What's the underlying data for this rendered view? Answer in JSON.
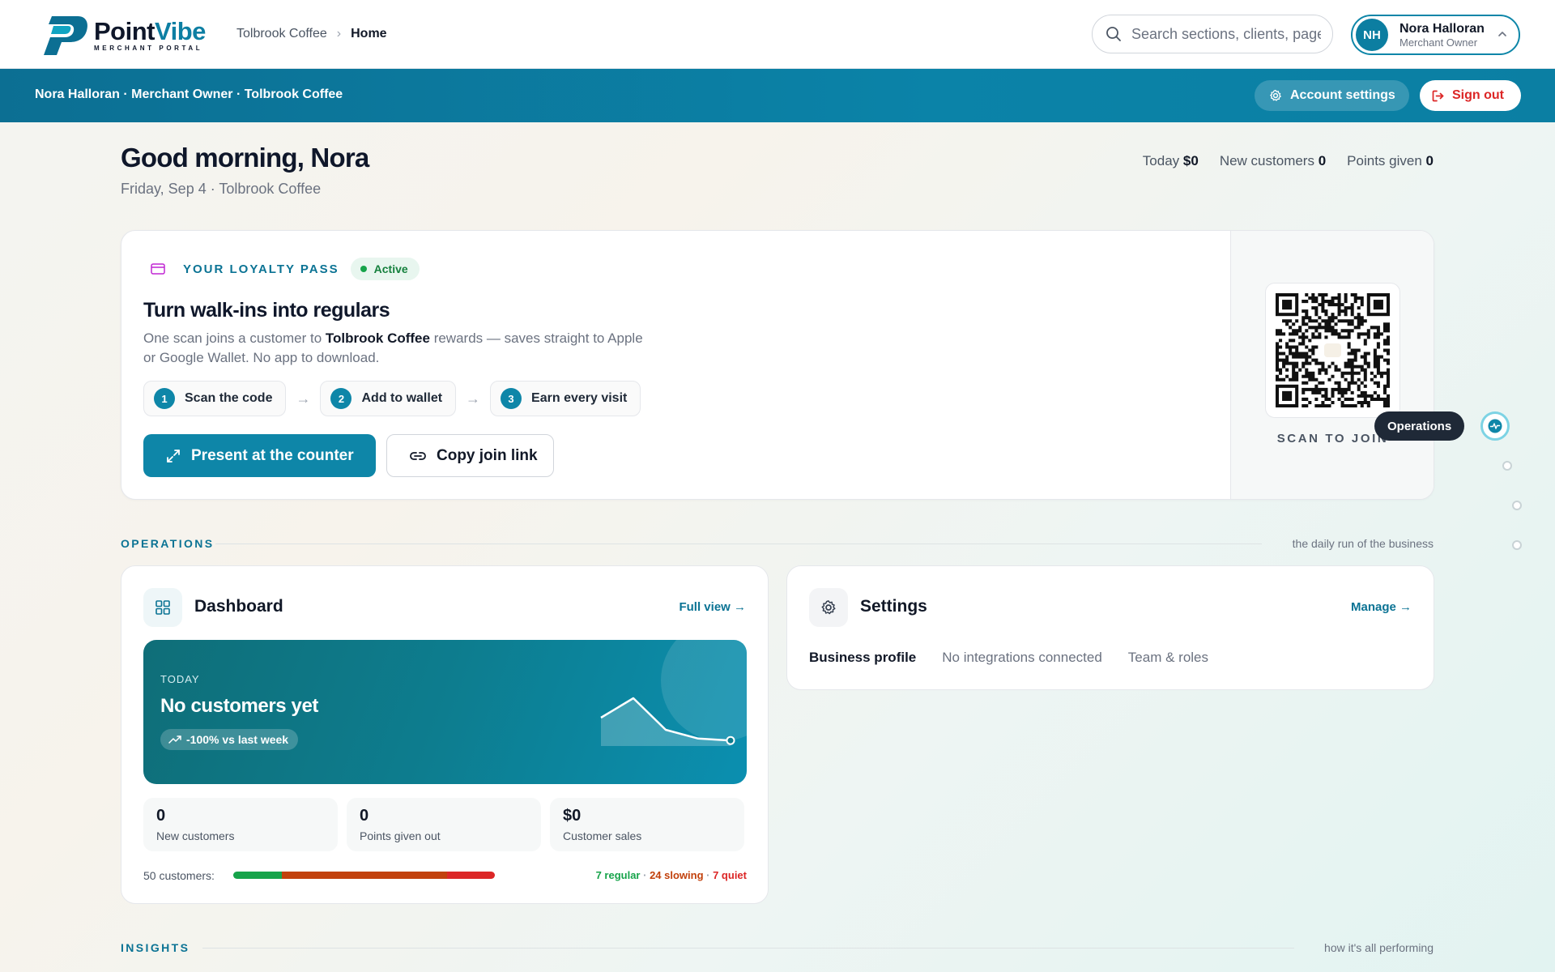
{
  "brand": {
    "name_part1": "Point",
    "name_part2": "Vibe",
    "subtitle": "MERCHANT PORTAL",
    "color_primary": "#0e86a8",
    "color_dark": "#0f172a"
  },
  "breadcrumb": {
    "parent": "Tolbrook Coffee",
    "separator": "›",
    "current": "Home"
  },
  "search": {
    "icon": "search-icon",
    "placeholder": "Search sections, clients, pages",
    "value": ""
  },
  "user": {
    "initials": "NH",
    "name": "Nora Halloran",
    "role": "Merchant Owner",
    "caret_icon": "chevron-up-icon"
  },
  "banner": {
    "text": "Nora Halloran · Merchant Owner · Tolbrook Coffee",
    "account_settings_label": "Account settings",
    "account_settings_icon": "gear-icon",
    "sign_out_label": "Sign out",
    "sign_out_icon": "logout-icon",
    "sign_out_color": "#dc2626"
  },
  "greeting": {
    "title": "Good morning, Nora",
    "subtitle": "Friday, Sep 4 · Tolbrook Coffee"
  },
  "summary": {
    "today_label": "Today",
    "today_value": "$0",
    "new_customers_label": "New customers",
    "new_customers_value": "0",
    "points_label": "Points given",
    "points_value": "0"
  },
  "loyalty_pass": {
    "eyebrow": "YOUR LOYALTY PASS",
    "icon": "card-icon",
    "status": "Active",
    "heading": "Turn walk-ins into regulars",
    "desc_before": "One scan joins a customer to ",
    "desc_business": "Tolbrook Coffee",
    "desc_after": " rewards — saves straight to Apple or Google Wallet. No app to download.",
    "steps": [
      {
        "num": "1",
        "label": "Scan the code"
      },
      {
        "num": "2",
        "label": "Add to wallet"
      },
      {
        "num": "3",
        "label": "Earn every visit"
      }
    ],
    "present_label": "Present at the counter",
    "copy_label": "Copy join link",
    "scan_label": "SCAN TO JOIN"
  },
  "side_nav": {
    "tooltip": "Operations",
    "active_icon": "activity-icon"
  },
  "operations": {
    "label": "OPERATIONS",
    "tagline": "the daily run of the business"
  },
  "dashboard": {
    "title": "Dashboard",
    "link": "Full view →",
    "today_eyebrow": "TODAY",
    "today_headline": "No customers yet",
    "trend": "-100% vs last week",
    "sparkline": [
      0.45,
      0.05,
      0.7,
      0.88,
      0.92
    ],
    "stats": [
      {
        "value": "0",
        "label": "New customers"
      },
      {
        "value": "0",
        "label": "Points given out"
      },
      {
        "value": "$0",
        "label": "Customer sales"
      }
    ],
    "segments_label": "50 customers:",
    "segments": [
      {
        "name": "regular",
        "count": 7,
        "color": "#16a34a"
      },
      {
        "name": "slowing",
        "count": 24,
        "color": "#c2410c"
      },
      {
        "name": "quiet",
        "count": 7,
        "color": "#dc2626"
      }
    ],
    "legend_regular": "7 regular",
    "legend_sep": " · ",
    "legend_slowing": "24 slowing",
    "legend_quiet": "7 quiet"
  },
  "settings": {
    "title": "Settings",
    "link": "Manage →",
    "items": [
      "Business profile",
      "No integrations connected",
      "Team & roles"
    ]
  },
  "insights": {
    "label": "INSIGHTS",
    "tagline": "how it's all performing"
  }
}
